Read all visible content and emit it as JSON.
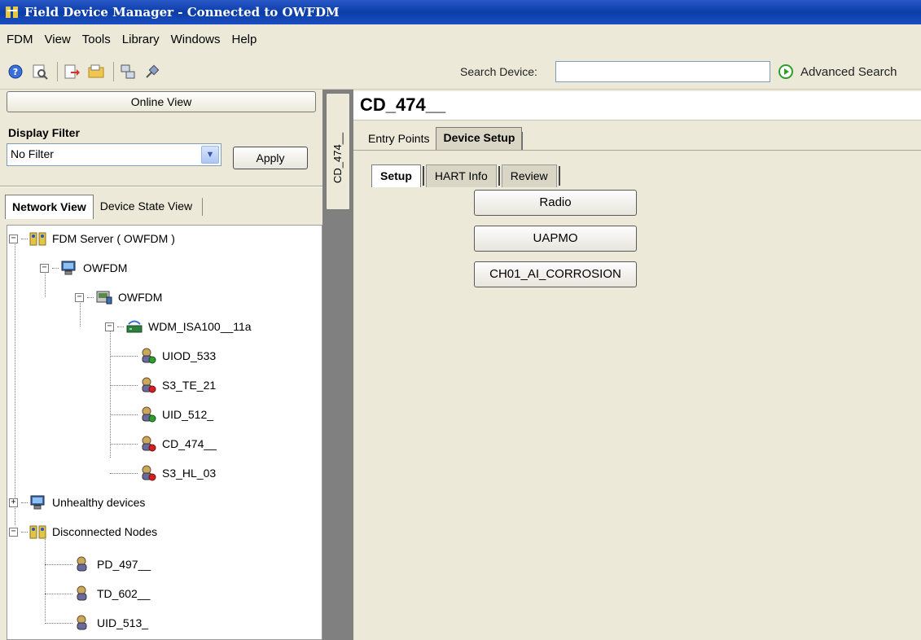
{
  "window": {
    "title": "Field Device Manager - Connected to OWFDM"
  },
  "menu": [
    "FDM",
    "View",
    "Tools",
    "Library",
    "Windows",
    "Help"
  ],
  "toolbar": {
    "search_label": "Search Device:",
    "search_value": "",
    "advanced_search": "Advanced Search"
  },
  "left": {
    "online_view": "Online View",
    "display_filter_label": "Display Filter",
    "filter_value": "No Filter",
    "apply": "Apply",
    "tabs": [
      "Network View",
      "Device State View"
    ]
  },
  "tree": [
    {
      "label": "FDM Server ( OWFDM )",
      "icon": "server-nodes-icon",
      "expander": "−"
    },
    {
      "label": "OWFDM",
      "icon": "computer-icon",
      "expander": "−"
    },
    {
      "label": "OWFDM",
      "icon": "network-card-icon",
      "expander": "−"
    },
    {
      "label": "WDM_ISA100__11a",
      "icon": "wireless-gateway-icon",
      "expander": "−"
    },
    {
      "label": "UIOD_533",
      "icon": "device-healthy-icon",
      "status": "healthy"
    },
    {
      "label": "S3_TE_21",
      "icon": "device-error-icon",
      "status": "error"
    },
    {
      "label": "UID_512_",
      "icon": "device-healthy-icon",
      "status": "healthy"
    },
    {
      "label": "CD_474__",
      "icon": "device-error-icon",
      "status": "error"
    },
    {
      "label": "S3_HL_03",
      "icon": "device-error-icon",
      "status": "error"
    },
    {
      "label": "Unhealthy devices",
      "icon": "computer-icon",
      "expander": "+"
    },
    {
      "label": "Disconnected Nodes",
      "icon": "server-nodes-icon",
      "expander": "−"
    },
    {
      "label": "PD_497__",
      "icon": "device-icon"
    },
    {
      "label": "TD_602__",
      "icon": "device-icon"
    },
    {
      "label": "UID_513_",
      "icon": "device-icon"
    }
  ],
  "vertical_tab": "CD_474__",
  "right": {
    "device_title": "CD_474__",
    "tabs": [
      "Entry Points",
      "Device Setup"
    ],
    "subtabs": [
      "Setup",
      "HART Info",
      "Review"
    ],
    "buttons": [
      "Radio",
      "UAPMO",
      "CH01_AI_CORROSION"
    ]
  },
  "colors": {
    "titlebar": "#0a3da8",
    "splitter": "#808080",
    "healthy": "#2e9e2e",
    "error": "#d42020"
  }
}
